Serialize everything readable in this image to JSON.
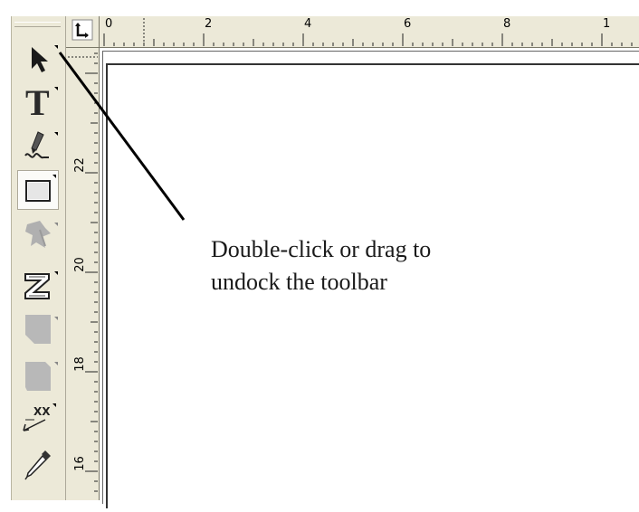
{
  "toolbar": {
    "tools": [
      {
        "name": "pick-tool",
        "icon": "arrow-pointer-icon",
        "active": false
      },
      {
        "name": "text-tool",
        "icon": "text-T-icon",
        "active": false
      },
      {
        "name": "freehand-tool",
        "icon": "pencil-icon",
        "active": false
      },
      {
        "name": "rectangle-tool",
        "icon": "rectangle-icon",
        "active": true
      },
      {
        "name": "shape-tool",
        "icon": "shape-icon",
        "active": false
      },
      {
        "name": "interactive-blend-tool",
        "icon": "blend-z-icon",
        "active": false
      },
      {
        "name": "fill-tool",
        "icon": "fill-shape-icon",
        "active": false
      },
      {
        "name": "outline-tool",
        "icon": "outline-shape-icon",
        "active": false
      },
      {
        "name": "dimension-tool",
        "icon": "dimension-xx-icon",
        "active": false
      },
      {
        "name": "eyedropper-tool",
        "icon": "eyedropper-icon",
        "active": false
      }
    ]
  },
  "ruler": {
    "horizontal_labels": [
      "0",
      "2",
      "4",
      "6",
      "8",
      "1"
    ],
    "vertical_labels": [
      "22",
      "20",
      "18",
      "16"
    ]
  },
  "callout": {
    "line1": "Double-click or drag to",
    "line2": "undock the toolbar"
  },
  "colors": {
    "toolbar_bg": "#ece9d8",
    "canvas_bg": "#ffffff",
    "callout_line": "#000000"
  }
}
